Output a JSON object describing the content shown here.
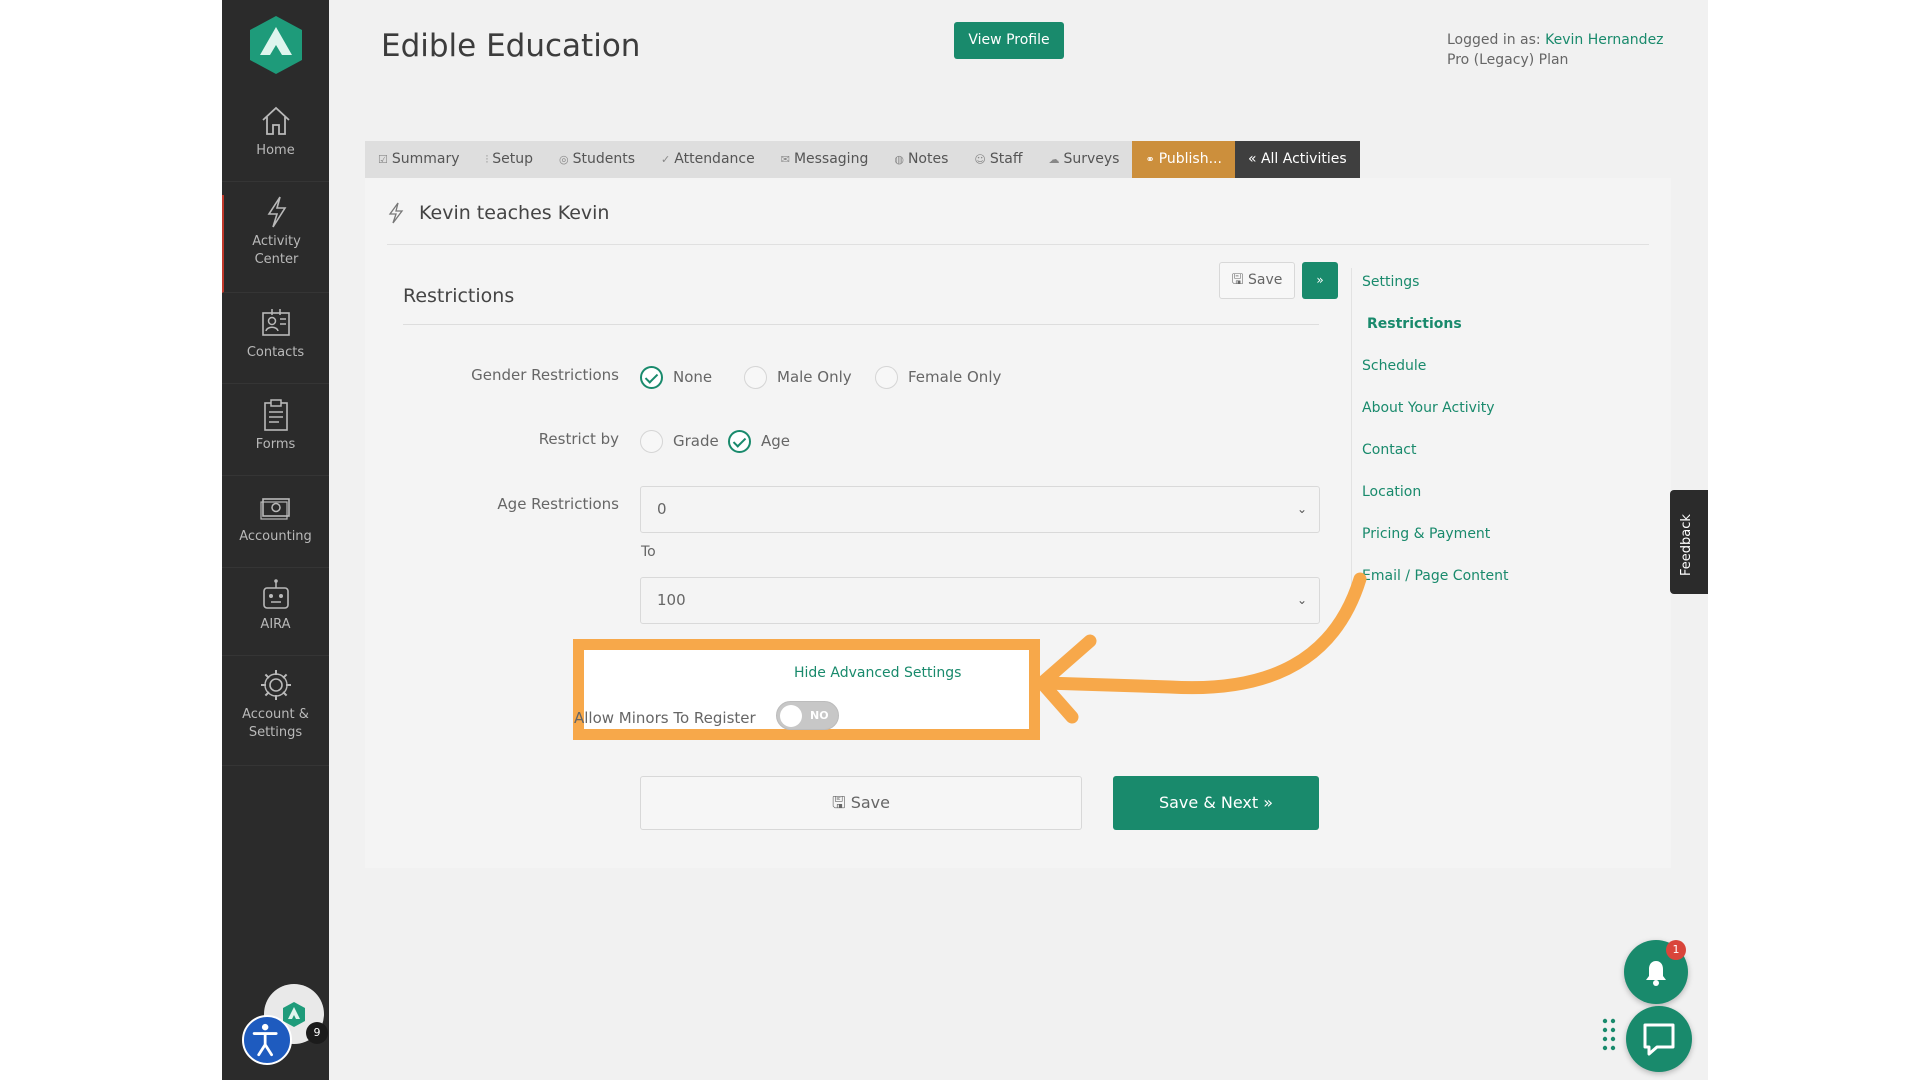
{
  "colors": {
    "brand_green": "#198a6c",
    "sidebar_bg": "#2b2b2b",
    "publish_tab": "#cc8f3c",
    "highlight_orange": "#f7a84a",
    "notification_red": "#d9453b"
  },
  "sidebar": {
    "logo_icon": "arrow-hexagon-logo-icon",
    "items": [
      {
        "label": "Home",
        "icon": "home-icon"
      },
      {
        "label": "Activity\nCenter",
        "icon": "lightning-icon",
        "active": true
      },
      {
        "label": "Contacts",
        "icon": "contacts-icon"
      },
      {
        "label": "Forms",
        "icon": "clipboard-icon"
      },
      {
        "label": "Accounting",
        "icon": "cash-icon"
      },
      {
        "label": "AIRA",
        "icon": "robot-icon"
      },
      {
        "label": "Account &\nSettings",
        "icon": "gear-icon"
      }
    ],
    "avatar_badge": "9",
    "accessibility_icon": "accessibility-icon"
  },
  "header": {
    "title": "Edible Education",
    "view_profile_label": "View Profile",
    "logged_in_prefix": "Logged in as:",
    "user_name": "Kevin Hernandez",
    "plan": "Pro (Legacy) Plan"
  },
  "tabs": [
    {
      "label": "Summary",
      "icon": "checkbox-icon"
    },
    {
      "label": "Setup",
      "icon": "sliders-icon"
    },
    {
      "label": "Students",
      "icon": "student-icon"
    },
    {
      "label": "Attendance",
      "icon": "check-icon"
    },
    {
      "label": "Messaging",
      "icon": "envelope-icon"
    },
    {
      "label": "Notes",
      "icon": "notes-icon"
    },
    {
      "label": "Staff",
      "icon": "staff-icon"
    },
    {
      "label": "Surveys",
      "icon": "cloud-icon"
    },
    {
      "label": "Publish...",
      "icon": "link-icon"
    },
    {
      "label": "« All Activities",
      "icon": ""
    }
  ],
  "activity": {
    "title": "Kevin teaches Kevin",
    "icon": "lightning-icon"
  },
  "form": {
    "section_title": "Restrictions",
    "top_save_label": "Save",
    "top_next_label": "»",
    "gender_label": "Gender Restrictions",
    "gender_options": [
      {
        "label": "None",
        "checked": true
      },
      {
        "label": "Male Only",
        "checked": false
      },
      {
        "label": "Female Only",
        "checked": false
      }
    ],
    "restrict_by_label": "Restrict by",
    "restrict_by_options": [
      {
        "label": "Grade",
        "checked": false
      },
      {
        "label": "Age",
        "checked": true
      }
    ],
    "age_label": "Age Restrictions",
    "age_from_value": "0",
    "to_label": "To",
    "age_to_value": "100",
    "hide_advanced_label": "Hide Advanced Settings",
    "minors_label": "Allow Minors To Register",
    "minors_toggle_text": "NO",
    "minors_toggle_on": false,
    "bottom_save_label": "Save",
    "bottom_next_label": "Save & Next »"
  },
  "side_nav": [
    {
      "label": "Settings",
      "current": false
    },
    {
      "label": "Restrictions",
      "current": true
    },
    {
      "label": "Schedule",
      "current": false
    },
    {
      "label": "About Your Activity",
      "current": false
    },
    {
      "label": "Contact",
      "current": false
    },
    {
      "label": "Location",
      "current": false
    },
    {
      "label": "Pricing & Payment",
      "current": false
    },
    {
      "label": "Email / Page Content",
      "current": false
    }
  ],
  "floating": {
    "feedback_label": "Feedback",
    "bell_badge": "1",
    "bell_icon": "bell-icon",
    "chat_icon": "chat-icon",
    "dots_icon": "drag-dots-icon"
  }
}
